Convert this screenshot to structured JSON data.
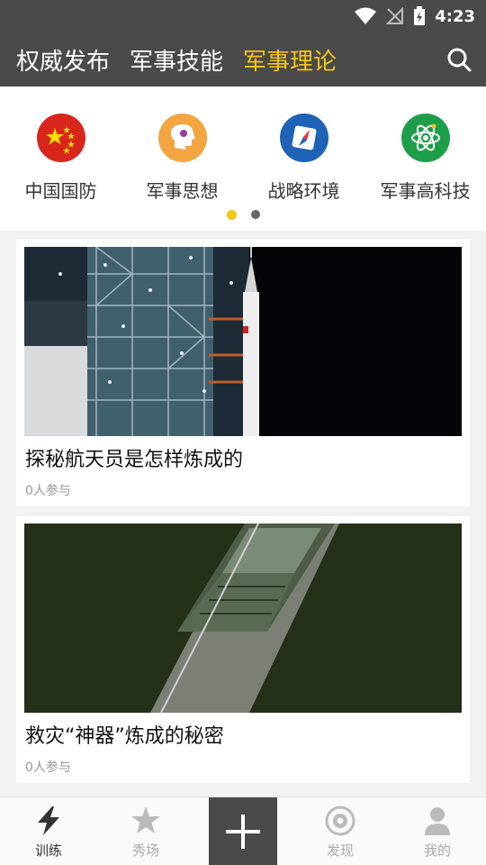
{
  "status_bar": {
    "time": "4:23"
  },
  "header": {
    "tabs": [
      {
        "label": "权威发布",
        "active": false
      },
      {
        "label": "军事技能",
        "active": false
      },
      {
        "label": "军事理论",
        "active": true
      }
    ],
    "search_icon": "search-icon"
  },
  "categories": {
    "items": [
      {
        "label": "中国国防",
        "icon": "china-flag-icon",
        "color": "#d9261c"
      },
      {
        "label": "军事思想",
        "icon": "head-idea-icon",
        "color": "#f2a541"
      },
      {
        "label": "战略环境",
        "icon": "compass-icon",
        "color": "#1e63b5"
      },
      {
        "label": "军事高科技",
        "icon": "atom-icon",
        "color": "#1f9e4a"
      }
    ],
    "pager": {
      "pages": 2,
      "current": 1
    }
  },
  "articles": [
    {
      "title": "探秘航天员是怎样炼成的",
      "meta": "0人参与",
      "image": "rocket-launch-tower-image"
    },
    {
      "title": "救灾“神器”炼成的秘密",
      "meta": "0人参与",
      "image": "military-truck-image"
    }
  ],
  "bottom_nav": {
    "items": [
      {
        "label": "训练",
        "icon": "lightning-icon",
        "active": true
      },
      {
        "label": "秀场",
        "icon": "star-icon",
        "active": false
      },
      {
        "label": "发现",
        "icon": "discover-icon",
        "active": false
      },
      {
        "label": "我的",
        "icon": "user-icon",
        "active": false
      }
    ],
    "add_icon": "plus-icon"
  },
  "colors": {
    "accent": "#f5c518",
    "header_bg": "#4a4a4a"
  }
}
